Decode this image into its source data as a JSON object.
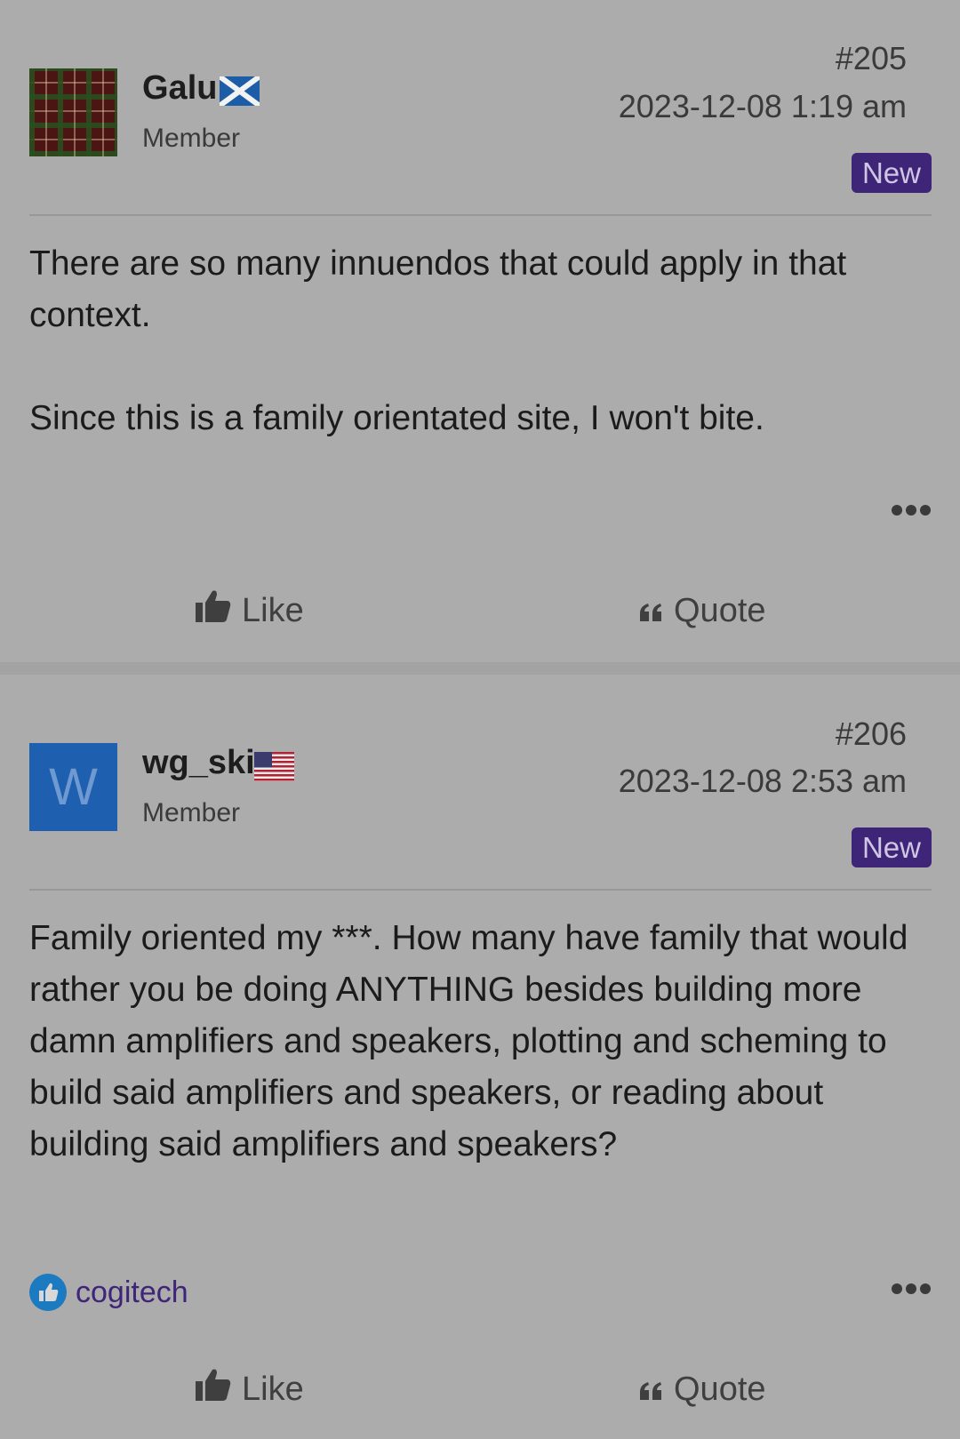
{
  "posts": [
    {
      "number": "#205",
      "date": "2023-12-08 1:19 am",
      "badge": "New",
      "author": {
        "name": "Galu",
        "role": "Member",
        "flag": "scotland-flag-icon",
        "avatar": "tartan-avatar"
      },
      "paragraphs": [
        "There are so many innuendos that could apply in that context.",
        "Since this is a family orientated site, I won't bite."
      ],
      "actions": {
        "like": "Like",
        "quote": "Quote"
      }
    },
    {
      "number": "#206",
      "date": "2023-12-08 2:53 am",
      "badge": "New",
      "author": {
        "name": "wg_ski",
        "role": "Member",
        "flag": "us-flag-icon",
        "avatar_letter": "W"
      },
      "paragraphs": [
        "Family oriented my ***. How many have family that would rather you be doing ANYTHING besides building more damn amplifiers and speakers, plotting and scheming to build said amplifiers and speakers, or reading about building said amplifiers and speakers?"
      ],
      "reactions": {
        "icon": "thumbs-up-reaction-icon",
        "users": "cogitech"
      },
      "actions": {
        "like": "Like",
        "quote": "Quote"
      }
    }
  ],
  "colors": {
    "background": "#acacac",
    "badge": "#3f2577",
    "avatar_blue": "#1e5fb0",
    "reaction_blue": "#1c7ac0"
  }
}
